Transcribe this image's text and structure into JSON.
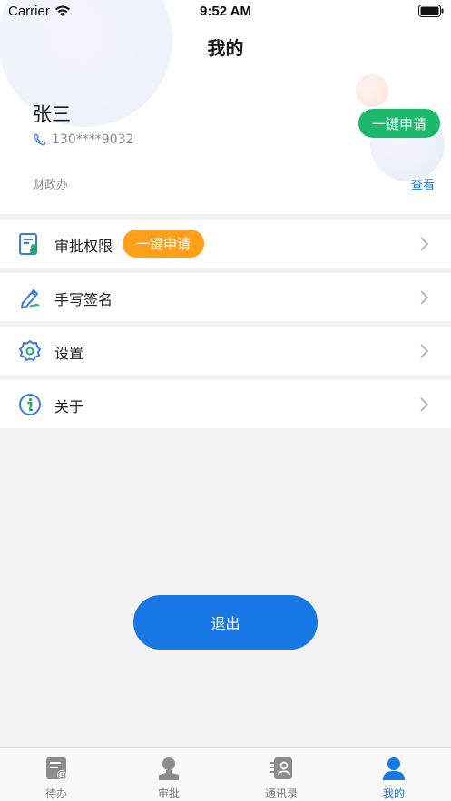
{
  "status_bar": {
    "carrier": "Carrier",
    "time": "9:52 AM"
  },
  "header": {
    "title": "我的"
  },
  "profile": {
    "name": "张三",
    "phone": "130****9032",
    "department": "财政办",
    "view_label": "查看",
    "apply_label": "一键申请"
  },
  "menu": [
    {
      "label": "审批权限",
      "icon": "approval-permission-icon",
      "badge": "一键申请"
    },
    {
      "label": "手写签名",
      "icon": "pen-icon"
    },
    {
      "label": "设置",
      "icon": "gear-icon"
    },
    {
      "label": "关于",
      "icon": "info-icon"
    }
  ],
  "logout_label": "退出",
  "tabs": [
    {
      "label": "待办",
      "icon": "todo-icon",
      "active": false
    },
    {
      "label": "审批",
      "icon": "person-icon",
      "active": false
    },
    {
      "label": "通讯录",
      "icon": "contacts-icon",
      "active": false
    },
    {
      "label": "我的",
      "icon": "user-icon",
      "active": true
    }
  ],
  "colors": {
    "accent_blue": "#1677e5",
    "green": "#1cb86b",
    "orange": "#ff9f1a",
    "background": "#f2f2f2"
  }
}
